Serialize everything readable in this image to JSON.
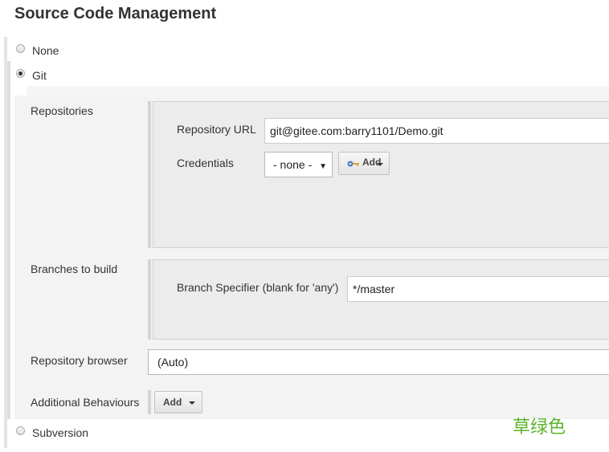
{
  "section": {
    "title": "Source Code Management"
  },
  "scm_options": {
    "none_label": "None",
    "git_label": "Git",
    "subversion_label": "Subversion",
    "selected": "Git"
  },
  "repositories": {
    "label": "Repositories",
    "url_label": "Repository URL",
    "url_value": "git@gitee.com:barry1101/Demo.git",
    "credentials_label": "Credentials",
    "credentials_selected": "- none -",
    "add_button_label": "Add"
  },
  "branches": {
    "label": "Branches to build",
    "specifier_label": "Branch Specifier (blank for 'any')",
    "specifier_value": "*/master"
  },
  "repository_browser": {
    "label": "Repository browser",
    "selected": "(Auto)"
  },
  "additional_behaviours": {
    "label": "Additional Behaviours",
    "add_button_label": "Add"
  },
  "watermark": {
    "text": "草绿色"
  },
  "colors": {
    "panel_bg": "#f3f3f3",
    "inset_bg": "#ececec",
    "watermark": "#5bb32a"
  }
}
